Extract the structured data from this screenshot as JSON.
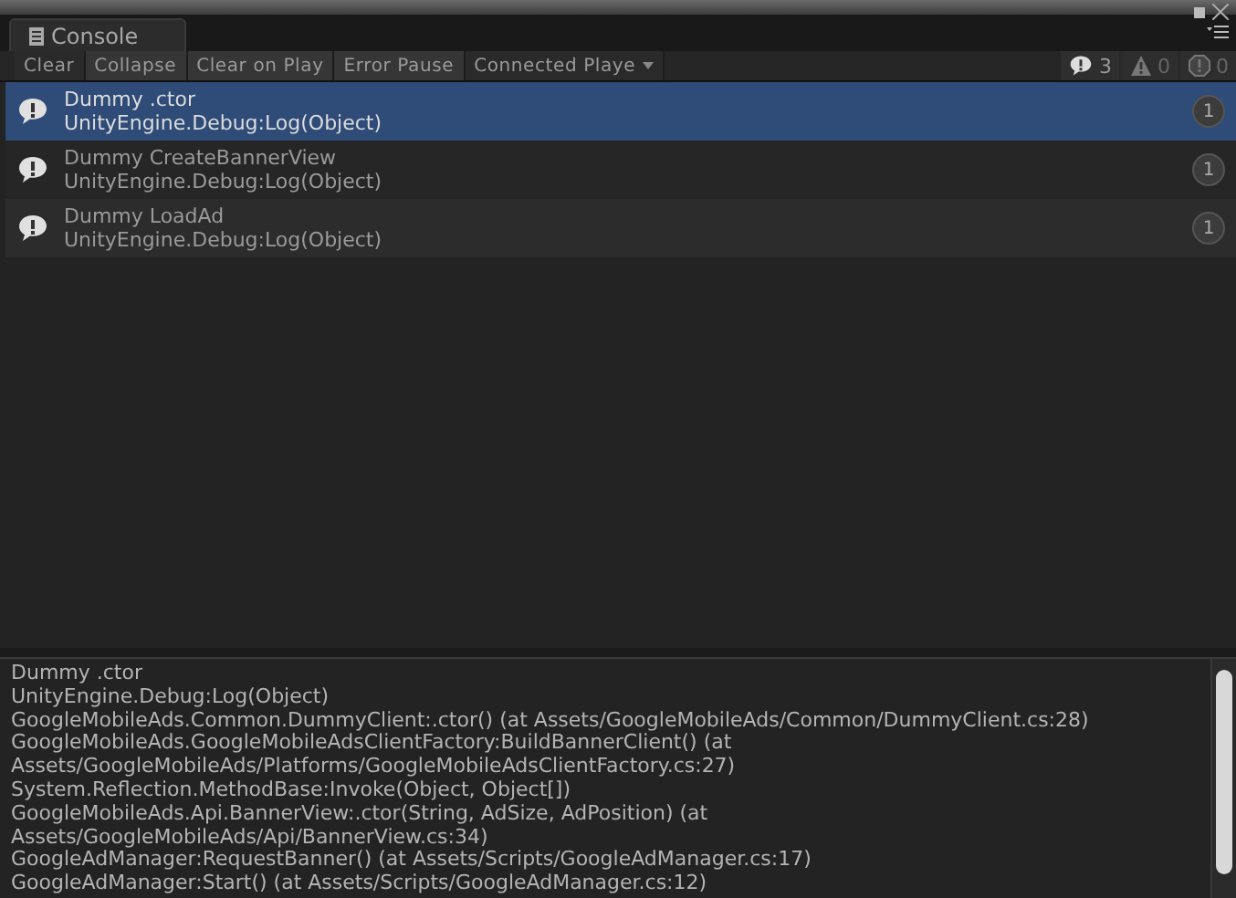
{
  "tab": {
    "title": "Console",
    "selected": true
  },
  "toolbar": [
    {
      "label": "Clear",
      "kind": "button",
      "on": false
    },
    {
      "label": "Collapse",
      "kind": "toggle",
      "on": true
    },
    {
      "label": "Clear on Play",
      "kind": "toggle",
      "on": true
    },
    {
      "label": "Error Pause",
      "kind": "toggle",
      "on": true
    },
    {
      "label": "Connected Playe",
      "kind": "dropdown",
      "on": false
    }
  ],
  "counters": [
    {
      "kind": "info",
      "count": "3",
      "dimmed": false
    },
    {
      "kind": "warning",
      "count": "0",
      "dimmed": true
    },
    {
      "kind": "error",
      "count": "0",
      "dimmed": true
    }
  ],
  "entries": [
    {
      "message": "Dummy .ctor",
      "source": "UnityEngine.Debug:Log(Object)",
      "count": "1",
      "selected": true
    },
    {
      "message": "Dummy CreateBannerView",
      "source": "UnityEngine.Debug:Log(Object)",
      "count": "1",
      "selected": false
    },
    {
      "message": "Dummy LoadAd",
      "source": "UnityEngine.Debug:Log(Object)",
      "count": "1",
      "selected": false
    }
  ],
  "details": [
    "Dummy .ctor",
    "UnityEngine.Debug:Log(Object)",
    "GoogleMobileAds.Common.DummyClient:.ctor() (at Assets/GoogleMobileAds/Common/DummyClient.cs:28)",
    "GoogleMobileAds.GoogleMobileAdsClientFactory:BuildBannerClient() (at",
    "Assets/GoogleMobileAds/Platforms/GoogleMobileAdsClientFactory.cs:27)",
    "System.Reflection.MethodBase:Invoke(Object, Object[])",
    "GoogleMobileAds.Api.BannerView:.ctor(String, AdSize, AdPosition) (at",
    "Assets/GoogleMobileAds/Api/BannerView.cs:34)",
    "GoogleAdManager:RequestBanner() (at Assets/Scripts/GoogleAdManager.cs:17)",
    "GoogleAdManager:Start() (at Assets/Scripts/GoogleAdManager.cs:12)"
  ]
}
